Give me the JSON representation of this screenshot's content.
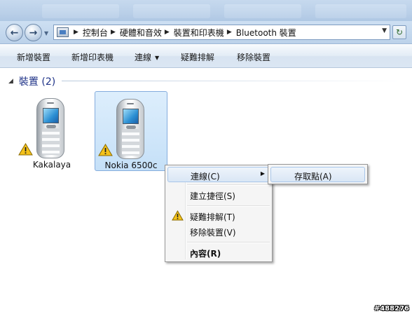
{
  "address_bar": {
    "breadcrumbs": [
      "控制台",
      "硬體和音效",
      "裝置和印表機",
      "Bluetooth 裝置"
    ]
  },
  "command_bar": {
    "add_device": "新增裝置",
    "add_printer": "新增印表機",
    "connect": "連線",
    "troubleshoot": "疑難排解",
    "remove_device": "移除裝置"
  },
  "group": {
    "label": "裝置 (2)"
  },
  "devices": [
    {
      "name": "Kakalaya",
      "status_icon": "warning-icon",
      "selected": false
    },
    {
      "name": "Nokia 6500c",
      "status_icon": "warning-icon",
      "selected": true
    }
  ],
  "context_menu": {
    "connect": "連線(C)",
    "create_shortcut": "建立捷徑(S)",
    "troubleshoot": "疑難排解(T)",
    "remove_device": "移除裝置(V)",
    "properties": "內容(R)"
  },
  "submenu": {
    "access_point": "存取點(A)"
  },
  "watermark": "#488276",
  "colors": {
    "group_label": "#1e3287",
    "selection": "#c5e0f8",
    "warning": "#f4c21b"
  }
}
